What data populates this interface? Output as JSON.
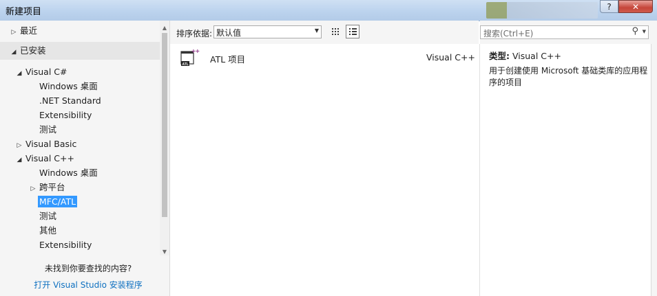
{
  "window": {
    "title": "新建项目",
    "help_label": "?",
    "close_label": "✕"
  },
  "tree": {
    "items": [
      {
        "label": "最近",
        "arrow": "▷",
        "level": 0
      },
      {
        "label": "已安装",
        "arrow": "◢",
        "level": 0
      },
      {
        "label": "Visual C#",
        "arrow": "◢",
        "level": 1
      },
      {
        "label": "Windows 桌面",
        "arrow": "",
        "level": 2
      },
      {
        "label": ".NET Standard",
        "arrow": "",
        "level": 2
      },
      {
        "label": "Extensibility",
        "arrow": "",
        "level": 2
      },
      {
        "label": "测试",
        "arrow": "",
        "level": 2
      },
      {
        "label": "Visual Basic",
        "arrow": "▷",
        "level": 1
      },
      {
        "label": "Visual C++",
        "arrow": "◢",
        "level": 1
      },
      {
        "label": "Windows 桌面",
        "arrow": "",
        "level": 2
      },
      {
        "label": "跨平台",
        "arrow": "▷",
        "level": 2
      },
      {
        "label": "MFC/ATL",
        "arrow": "",
        "level": 2,
        "selected": true
      },
      {
        "label": "测试",
        "arrow": "",
        "level": 2
      },
      {
        "label": "其他",
        "arrow": "",
        "level": 2
      },
      {
        "label": "Extensibility",
        "arrow": "",
        "level": 2
      }
    ]
  },
  "left_footer": {
    "not_found": "未找到你要查找的内容?",
    "installer_link": "打开 Visual Studio 安装程序"
  },
  "toolbar": {
    "sort_label": "排序依据:",
    "sort_value": "默认值"
  },
  "search": {
    "placeholder": "搜索(Ctrl+E)"
  },
  "templates": [
    {
      "name": "ATL 项目",
      "language": "Visual C++",
      "icon": "atl-project-icon"
    }
  ],
  "details": {
    "type_key": "类型:",
    "type_value": "Visual C++",
    "description": "用于创建使用 Microsoft 基础类库的应用程序的项目"
  },
  "colors": {
    "selection": "#3399ff",
    "link": "#0e70c0",
    "close": "#c5463a"
  }
}
